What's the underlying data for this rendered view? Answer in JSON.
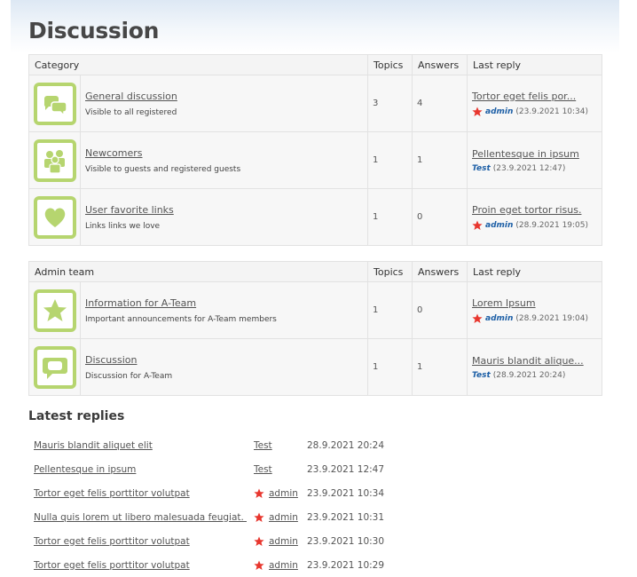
{
  "page": {
    "title": "Discussion"
  },
  "category_table": {
    "headers": {
      "category": "Category",
      "topics": "Topics",
      "answers": "Answers",
      "last_reply": "Last reply"
    },
    "rows": [
      {
        "icon": "speech-bubbles-icon",
        "title": "General discussion",
        "description": "Visible to all registered",
        "topics": "3",
        "answers": "4",
        "last_title": "Tortor eget felis por...",
        "last_user": "admin",
        "last_user_is_admin": true,
        "last_date": "(23.9.2021 10:34)"
      },
      {
        "icon": "group-icon",
        "title": "Newcomers",
        "description": "Visible to guests and registered guests",
        "topics": "1",
        "answers": "1",
        "last_title": "Pellentesque in ipsum",
        "last_user": "Test",
        "last_user_is_admin": false,
        "last_date": "(23.9.2021 12:47)"
      },
      {
        "icon": "heart-icon",
        "title": "User favorite links",
        "description": "Links links we love",
        "topics": "1",
        "answers": "0",
        "last_title": "Proin eget tortor risus.",
        "last_user": "admin",
        "last_user_is_admin": true,
        "last_date": "(28.9.2021 19:05)"
      }
    ]
  },
  "admin_table": {
    "headers": {
      "category": "Admin team",
      "topics": "Topics",
      "answers": "Answers",
      "last_reply": "Last reply"
    },
    "rows": [
      {
        "icon": "star-icon",
        "title": "Information for A-Team",
        "description": "Important announcements for A-Team members",
        "topics": "1",
        "answers": "0",
        "last_title": "Lorem Ipsum",
        "last_user": "admin",
        "last_user_is_admin": true,
        "last_date": "(28.9.2021 19:04)"
      },
      {
        "icon": "speech-bubble-icon",
        "title": "Discussion",
        "description": "Discussion for A-Team",
        "topics": "1",
        "answers": "1",
        "last_title": "Mauris blandit alique...",
        "last_user": "Test",
        "last_user_is_admin": false,
        "last_date": "(28.9.2021 20:24)"
      }
    ]
  },
  "latest": {
    "heading": "Latest replies",
    "rows": [
      {
        "title": "Mauris blandit aliquet elit",
        "user": "Test",
        "admin": false,
        "date": "28.9.2021 20:24"
      },
      {
        "title": "Pellentesque in ipsum",
        "user": "Test",
        "admin": false,
        "date": "23.9.2021 12:47"
      },
      {
        "title": "Tortor eget felis porttitor volutpat",
        "user": "admin",
        "admin": true,
        "date": "23.9.2021 10:34"
      },
      {
        "title": "Nulla quis lorem ut libero malesuada feugiat. Pr",
        "user": "admin",
        "admin": true,
        "date": "23.9.2021 10:31"
      },
      {
        "title": "Tortor eget felis porttitor volutpat",
        "user": "admin",
        "admin": true,
        "date": "23.9.2021 10:30"
      },
      {
        "title": "Tortor eget felis porttitor volutpat",
        "user": "admin",
        "admin": true,
        "date": "23.9.2021 10:29"
      }
    ]
  },
  "colors": {
    "icon_green": "#b6d56f",
    "admin_star": "#e8362e",
    "user_link": "#1d5fa6"
  }
}
